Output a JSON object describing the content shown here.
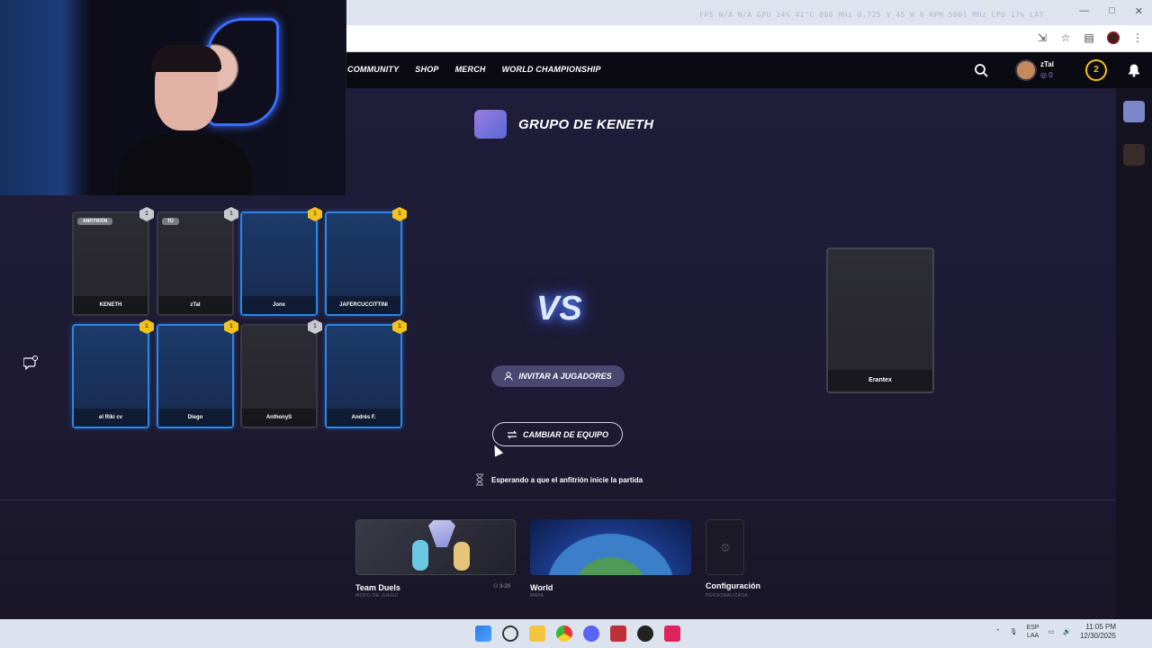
{
  "browser": {
    "hud": "FPS N/A N/A  GPU 24% 41°C 880 MHz 0.725 V 45 W 0 RPM 5001 MHz  CPU 17% LAT",
    "window_controls": [
      "—",
      "□",
      "✕"
    ]
  },
  "nav": {
    "links": [
      "COMMUNITY",
      "SHOP",
      "MERCH",
      "WORLD CHAMPIONSHIP"
    ],
    "user_name": "zTal",
    "coins": "0",
    "level": "2"
  },
  "group": {
    "title": "GRUPO DE KENETH"
  },
  "team_cards": [
    {
      "name": "KENETH",
      "tag": "ANFITRIÓN",
      "badge": "1",
      "style": "gray",
      "badge_style": "silver"
    },
    {
      "name": "zTal",
      "tag": "TÚ",
      "badge": "1",
      "style": "gray",
      "badge_style": "silver"
    },
    {
      "name": "Jonx",
      "tag": "",
      "badge": "1",
      "style": "blue",
      "badge_style": "gold"
    },
    {
      "name": "JAFERCUCCITTINI",
      "tag": "",
      "badge": "1",
      "style": "blue",
      "badge_style": "gold"
    },
    {
      "name": "el Riki cv",
      "tag": "",
      "badge": "1",
      "style": "blue",
      "badge_style": "gold"
    },
    {
      "name": "Diego",
      "tag": "",
      "badge": "1",
      "style": "blue",
      "badge_style": "gold"
    },
    {
      "name": "AnthonyS",
      "tag": "",
      "badge": "1",
      "style": "gray",
      "badge_style": "silver"
    },
    {
      "name": "Andrés F.",
      "tag": "",
      "badge": "1",
      "style": "blue",
      "badge_style": "gold"
    }
  ],
  "opponent": {
    "name": "Erantex"
  },
  "vs_label": "VS",
  "buttons": {
    "invite": "INVITAR A JUGADORES",
    "switch_team": "CAMBIAR DE EQUIPO"
  },
  "status": {
    "waiting": "Esperando a que el anfitrión inicie la partida"
  },
  "modes": {
    "team": {
      "title": "Team Duels",
      "subtitle": "MODO DE JUEGO",
      "count": "3-20"
    },
    "world": {
      "title": "World",
      "subtitle": "MAPA"
    },
    "config": {
      "title": "Configuración",
      "subtitle": "PERSONALIZADA"
    }
  },
  "taskbar": {
    "lang_1": "ESP",
    "lang_2": "LAA",
    "time": "11:05 PM",
    "date": "12/30/2025"
  }
}
